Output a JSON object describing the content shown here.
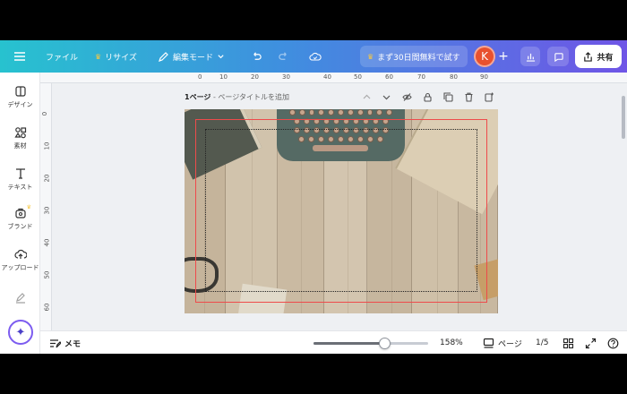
{
  "topbar": {
    "file_label": "ファイル",
    "resize_label": "リサイズ",
    "edit_mode_label": "編集モード",
    "trial_label": "まず30日間無料で試す",
    "avatar_initial": "K",
    "share_label": "共有"
  },
  "sidebar": {
    "items": [
      {
        "label": "デザイン",
        "icon": "design-icon"
      },
      {
        "label": "素材",
        "icon": "elements-icon"
      },
      {
        "label": "テキスト",
        "icon": "text-icon"
      },
      {
        "label": "ブランド",
        "icon": "brand-icon"
      },
      {
        "label": "アップロード",
        "icon": "upload-icon"
      },
      {
        "label": "",
        "icon": "draw-icon"
      }
    ]
  },
  "ruler": {
    "top_ticks": [
      "0",
      "10",
      "20",
      "30",
      "40",
      "50",
      "60",
      "70",
      "80",
      "90"
    ],
    "left_ticks": [
      "0",
      "10",
      "20",
      "30",
      "40",
      "50",
      "60"
    ]
  },
  "page": {
    "number_label": "1ページ",
    "title_placeholder": " - ページタイトルを追加"
  },
  "bottombar": {
    "memo_label": "メモ",
    "zoom_value": 0.62,
    "zoom_label": "158%",
    "page_label": "ページ",
    "page_count": "1/5"
  },
  "colors": {
    "accent": "#7c5cf0",
    "selection": "#ee4b4b",
    "avatar": "#e8512f"
  }
}
